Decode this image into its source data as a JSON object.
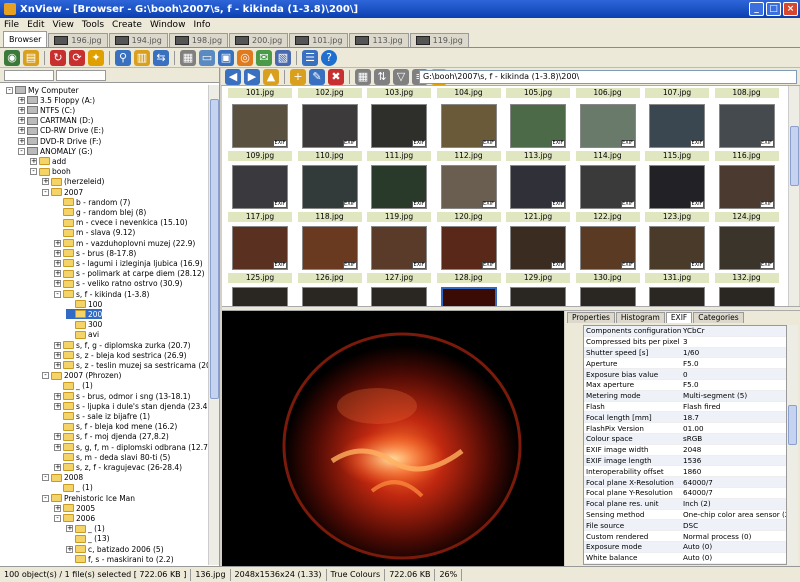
{
  "window": {
    "title": "XnView - [Browser - G:\\booh\\2007\\s, f - kikinda (1-3.8)\\200\\]"
  },
  "menu": [
    "File",
    "Edit",
    "View",
    "Tools",
    "Create",
    "Window",
    "Info"
  ],
  "tabs": [
    {
      "label": "Browser",
      "active": true
    },
    {
      "label": "196.jpg"
    },
    {
      "label": "194.jpg"
    },
    {
      "label": "198.jpg"
    },
    {
      "label": "200.jpg"
    },
    {
      "label": "101.jpg"
    },
    {
      "label": "113.jpg"
    },
    {
      "label": "119.jpg"
    }
  ],
  "path": "G:\\booh\\2007\\s, f - kikinda (1-3.8)\\200\\",
  "tree": [
    {
      "label": "My Computer",
      "depth": 0,
      "exp": "-",
      "icon": "computer"
    },
    {
      "label": "3.5 Floppy (A:)",
      "depth": 1,
      "exp": "+",
      "icon": "drive"
    },
    {
      "label": "NTFS (C:)",
      "depth": 1,
      "exp": "+",
      "icon": "drive"
    },
    {
      "label": "CARTMAN (D:)",
      "depth": 1,
      "exp": "+",
      "icon": "drive"
    },
    {
      "label": "CD-RW Drive (E:)",
      "depth": 1,
      "exp": "+",
      "icon": "drive"
    },
    {
      "label": "DVD-R Drive (F:)",
      "depth": 1,
      "exp": "+",
      "icon": "drive"
    },
    {
      "label": "ANOMALY (G:)",
      "depth": 1,
      "exp": "-",
      "icon": "drive"
    },
    {
      "label": "add",
      "depth": 2,
      "exp": "+",
      "icon": "folder"
    },
    {
      "label": "booh",
      "depth": 2,
      "exp": "-",
      "icon": "folder"
    },
    {
      "label": "(herzeleid)",
      "depth": 3,
      "exp": "+",
      "icon": "folder"
    },
    {
      "label": "2007",
      "depth": 3,
      "exp": "-",
      "icon": "folder"
    },
    {
      "label": "b - random (7)",
      "depth": 4,
      "exp": "",
      "icon": "folder"
    },
    {
      "label": "g - random blej (8)",
      "depth": 4,
      "exp": "",
      "icon": "folder"
    },
    {
      "label": "m - cvece i nevenkica (15.10)",
      "depth": 4,
      "exp": "",
      "icon": "folder"
    },
    {
      "label": "m - slava (9.12)",
      "depth": 4,
      "exp": "",
      "icon": "folder"
    },
    {
      "label": "m - vazduhoplovni muzej (22.9)",
      "depth": 4,
      "exp": "+",
      "icon": "folder"
    },
    {
      "label": "s - brus (8-17.8)",
      "depth": 4,
      "exp": "+",
      "icon": "folder"
    },
    {
      "label": "s - lagumi i izleginja ljubica (16.9)",
      "depth": 4,
      "exp": "+",
      "icon": "folder"
    },
    {
      "label": "s - polimark at carpe diem (28.12)",
      "depth": 4,
      "exp": "+",
      "icon": "folder"
    },
    {
      "label": "s - veliko ratno ostrvo (30.9)",
      "depth": 4,
      "exp": "+",
      "icon": "folder"
    },
    {
      "label": "s, f - kikinda (1-3.8)",
      "depth": 4,
      "exp": "-",
      "icon": "folder"
    },
    {
      "label": "100",
      "depth": 5,
      "exp": "",
      "icon": "folder"
    },
    {
      "label": "200",
      "depth": 5,
      "exp": "",
      "icon": "folder",
      "selected": true
    },
    {
      "label": "300",
      "depth": 5,
      "exp": "",
      "icon": "folder"
    },
    {
      "label": "avi",
      "depth": 5,
      "exp": "",
      "icon": "folder"
    },
    {
      "label": "s, f, g - diplomska zurka (20.7)",
      "depth": 4,
      "exp": "+",
      "icon": "folder"
    },
    {
      "label": "s, z - bleja kod sestrica (26.9)",
      "depth": 4,
      "exp": "+",
      "icon": "folder"
    },
    {
      "label": "s, z - teslin muzej sa sestricama (20.9)",
      "depth": 4,
      "exp": "+",
      "icon": "folder"
    },
    {
      "label": "2007 (Phrozen)",
      "depth": 3,
      "exp": "-",
      "icon": "folder"
    },
    {
      "label": "_ (1)",
      "depth": 4,
      "exp": "",
      "icon": "folder"
    },
    {
      "label": "s - brus, odmor i sng (13-18.1)",
      "depth": 4,
      "exp": "+",
      "icon": "folder"
    },
    {
      "label": "s - ljupka i dule's stan djenda (23.4)",
      "depth": 4,
      "exp": "+",
      "icon": "folder"
    },
    {
      "label": "s - sale iz bijafre (1)",
      "depth": 4,
      "exp": "",
      "icon": "folder"
    },
    {
      "label": "s, f - bleja kod mene (16.2)",
      "depth": 4,
      "exp": "",
      "icon": "folder"
    },
    {
      "label": "s, f - moj djenda (27,8.2)",
      "depth": 4,
      "exp": "+",
      "icon": "folder"
    },
    {
      "label": "s, g, f, m - diplomski odbrana (12.7)",
      "depth": 4,
      "exp": "+",
      "icon": "folder"
    },
    {
      "label": "s, m - deda slavi 80-ti (5)",
      "depth": 4,
      "exp": "",
      "icon": "folder"
    },
    {
      "label": "s, z, f - kragujevac (26-28.4)",
      "depth": 4,
      "exp": "+",
      "icon": "folder"
    },
    {
      "label": "2008",
      "depth": 3,
      "exp": "-",
      "icon": "folder"
    },
    {
      "label": "_ (1)",
      "depth": 4,
      "exp": "",
      "icon": "folder"
    },
    {
      "label": "Prehistoric Ice Man",
      "depth": 3,
      "exp": "-",
      "icon": "folder"
    },
    {
      "label": "2005",
      "depth": 4,
      "exp": "+",
      "icon": "folder"
    },
    {
      "label": "2006",
      "depth": 4,
      "exp": "-",
      "icon": "folder"
    },
    {
      "label": "_ (1)",
      "depth": 5,
      "exp": "+",
      "icon": "folder"
    },
    {
      "label": "_ (13)",
      "depth": 5,
      "exp": "",
      "icon": "folder"
    },
    {
      "label": "c, batizado 2006 (5)",
      "depth": 5,
      "exp": "+",
      "icon": "folder"
    },
    {
      "label": "f, s - maskirani to (2.2)",
      "depth": 5,
      "exp": "",
      "icon": "folder"
    }
  ],
  "top_labels": [
    "101.jpg",
    "102.jpg",
    "103.jpg",
    "104.jpg",
    "105.jpg",
    "106.jpg",
    "107.jpg",
    "108.jpg"
  ],
  "thumbnails": [
    {
      "name": "109.jpg",
      "color": "#5a5040",
      "exif": true
    },
    {
      "name": "110.jpg",
      "color": "#3c3a3a",
      "exif": true
    },
    {
      "name": "111.jpg",
      "color": "#2e2e2a",
      "exif": true
    },
    {
      "name": "112.jpg",
      "color": "#6a5a3a",
      "exif": true
    },
    {
      "name": "113.jpg",
      "color": "#4c6a48",
      "exif": true
    },
    {
      "name": "114.jpg",
      "color": "#6a7a6a",
      "exif": true
    },
    {
      "name": "115.jpg",
      "color": "#3a4650",
      "exif": true
    },
    {
      "name": "116.jpg",
      "color": "#454a4e",
      "exif": true
    },
    {
      "name": "117.jpg",
      "color": "#3a3a3e",
      "exif": true
    },
    {
      "name": "118.jpg",
      "color": "#333a3a",
      "exif": true
    },
    {
      "name": "119.jpg",
      "color": "#2a3a2a",
      "exif": true
    },
    {
      "name": "120.jpg",
      "color": "#6a5e50",
      "exif": true
    },
    {
      "name": "121.jpg",
      "color": "#303038",
      "exif": true
    },
    {
      "name": "122.jpg",
      "color": "#3a3a3a",
      "exif": true
    },
    {
      "name": "123.jpg",
      "color": "#222226",
      "exif": true
    },
    {
      "name": "124.jpg",
      "color": "#4a3a30",
      "exif": true
    },
    {
      "name": "125.jpg",
      "color": "#5a3020",
      "exif": true
    },
    {
      "name": "126.jpg",
      "color": "#6a3a20",
      "exif": true
    },
    {
      "name": "127.jpg",
      "color": "#5a3a28",
      "exif": true
    },
    {
      "name": "128.jpg",
      "color": "#5a2818",
      "exif": true
    },
    {
      "name": "129.jpg",
      "color": "#3a2c20",
      "exif": true
    },
    {
      "name": "130.jpg",
      "color": "#5a3a22",
      "exif": true
    },
    {
      "name": "131.jpg",
      "color": "#4a3a2a",
      "exif": true
    },
    {
      "name": "132.jpg",
      "color": "#3a342a",
      "exif": true
    }
  ],
  "info_tabs": [
    {
      "label": "Properties"
    },
    {
      "label": "Histogram"
    },
    {
      "label": "EXIF",
      "active": true
    },
    {
      "label": "Categories"
    }
  ],
  "exif": [
    {
      "k": "Components configuration",
      "v": "YCbCr"
    },
    {
      "k": "Compressed bits per pixel",
      "v": "3"
    },
    {
      "k": "Shutter speed [s]",
      "v": "1/60"
    },
    {
      "k": "Aperture",
      "v": "F5.0"
    },
    {
      "k": "Exposure bias value",
      "v": "0"
    },
    {
      "k": "Max aperture",
      "v": "F5.0"
    },
    {
      "k": "Metering mode",
      "v": "Multi-segment (5)"
    },
    {
      "k": "Flash",
      "v": "Flash fired"
    },
    {
      "k": "Focal length [mm]",
      "v": "18.7"
    },
    {
      "k": "FlashPix Version",
      "v": "01.00"
    },
    {
      "k": "Colour space",
      "v": "sRGB"
    },
    {
      "k": "EXIF image width",
      "v": "2048"
    },
    {
      "k": "EXIF image length",
      "v": "1536"
    },
    {
      "k": "Interoperability offset",
      "v": "1860"
    },
    {
      "k": "Focal plane X-Resolution",
      "v": "64000/7"
    },
    {
      "k": "Focal plane Y-Resolution",
      "v": "64000/7"
    },
    {
      "k": "Focal plane res. unit",
      "v": "Inch (2)"
    },
    {
      "k": "Sensing method",
      "v": "One-chip color area sensor (2)"
    },
    {
      "k": "File source",
      "v": "DSC"
    },
    {
      "k": "Custom rendered",
      "v": "Normal process (0)"
    },
    {
      "k": "Exposure mode",
      "v": "Auto (0)"
    },
    {
      "k": "White balance",
      "v": "Auto (0)"
    }
  ],
  "status": [
    "100 object(s) / 1 file(s) selected  [ 722.06 KB ]",
    "136.jpg",
    "2048x1536x24 (1.33)",
    "True Colours",
    "722.06 KB",
    "26%"
  ],
  "colors": {
    "title": "#0a3fb0",
    "selection": "#316ac5",
    "thumb_label": "#dfe6c0"
  }
}
